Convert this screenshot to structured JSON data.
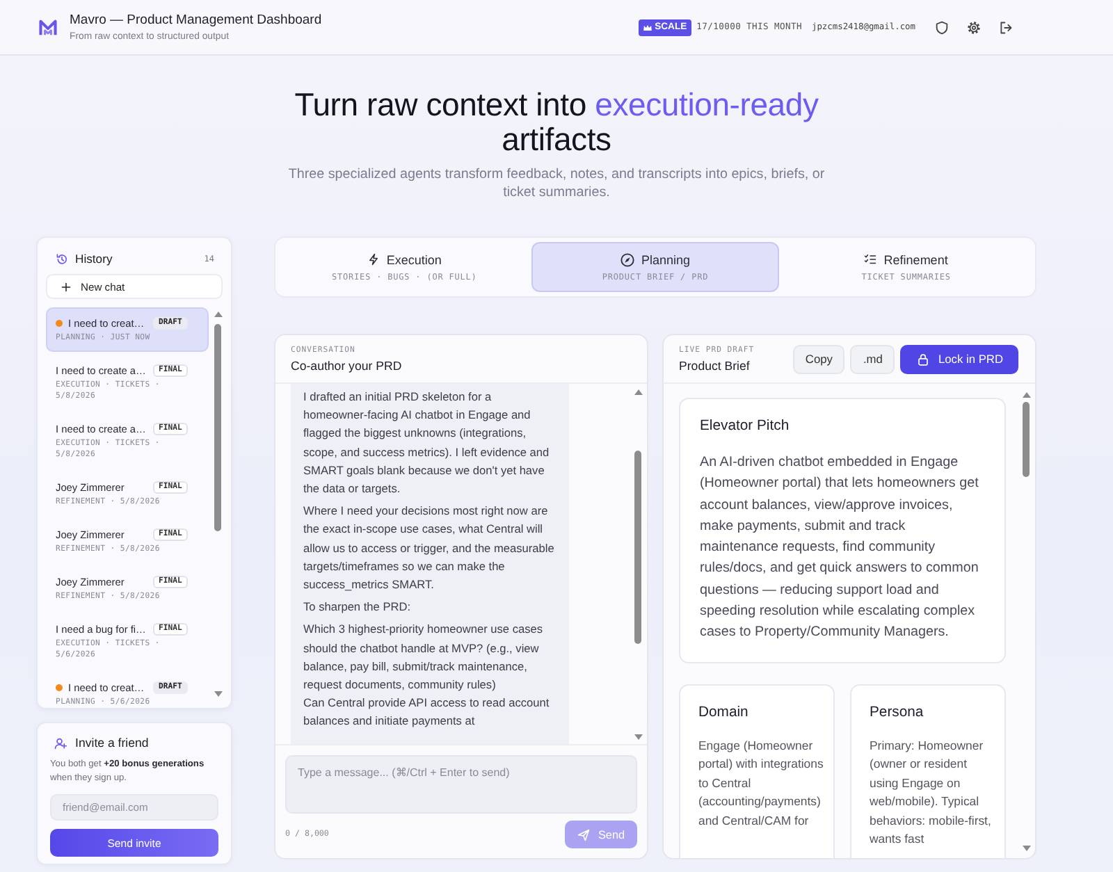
{
  "app": {
    "title": "Mavro — Product Management Dashboard",
    "subtitle": "From raw context to structured output"
  },
  "account": {
    "plan": "SCALE",
    "usage": "17/10000 THIS MONTH",
    "email": "jpzcms2418@gmail.com"
  },
  "hero": {
    "title_start": "Turn raw context into",
    "title_highlight": "execution-ready",
    "title_end": "artifacts",
    "subtitle": "Three specialized agents transform feedback, notes, and transcripts into epics, briefs, or ticket summaries."
  },
  "history": {
    "title": "History",
    "count": "14",
    "new_chat": "New chat",
    "items": [
      {
        "title": "I need to creat…",
        "status": "DRAFT",
        "draft": true,
        "meta": "PLANNING · JUST NOW",
        "selected": true
      },
      {
        "title": "I need to create a…",
        "status": "FINAL",
        "draft": false,
        "meta": "EXECUTION · TICKETS · 5/8/2026",
        "selected": false
      },
      {
        "title": "I need to create a…",
        "status": "FINAL",
        "draft": false,
        "meta": "EXECUTION · TICKETS · 5/8/2026",
        "selected": false
      },
      {
        "title": "Joey Zimmerer",
        "status": "FINAL",
        "draft": false,
        "meta": "REFINEMENT · 5/8/2026",
        "selected": false
      },
      {
        "title": "Joey Zimmerer",
        "status": "FINAL",
        "draft": false,
        "meta": "REFINEMENT · 5/8/2026",
        "selected": false
      },
      {
        "title": "Joey Zimmerer",
        "status": "FINAL",
        "draft": false,
        "meta": "REFINEMENT · 5/8/2026",
        "selected": false
      },
      {
        "title": "I need a bug for fi…",
        "status": "FINAL",
        "draft": false,
        "meta": "EXECUTION · TICKETS · 5/6/2026",
        "selected": false
      },
      {
        "title": "I need to creat…",
        "status": "DRAFT",
        "draft": true,
        "meta": "PLANNING · 5/6/2026",
        "selected": false
      }
    ]
  },
  "invite": {
    "title": "Invite a friend",
    "text": "You both get **+20 bonus generations** when they sign up.",
    "placeholder": "friend@email.com",
    "button": "Send invite"
  },
  "tabs": [
    {
      "label": "Execution",
      "sub": "STORIES · BUGS · (OR FULL)",
      "selected": false
    },
    {
      "label": "Planning",
      "sub": "PRODUCT BRIEF / PRD",
      "selected": true
    },
    {
      "label": "Refinement",
      "sub": "TICKET SUMMARIES",
      "selected": false
    }
  ],
  "conversation": {
    "eyebrow": "CONVERSATION",
    "title": "Co-author your PRD",
    "message": {
      "paragraphs": [
        "I drafted an initial PRD skeleton for a homeowner-facing AI chatbot in Engage and flagged the biggest unknowns (integrations, scope, and success metrics). I left evidence and SMART goals blank because we don't yet have the data or targets.",
        "Where I need your decisions most right now are the exact in-scope use cases, what Central will allow us to access or trigger, and the measurable targets/timeframes so we can make the success_metrics SMART.",
        "To sharpen the PRD:"
      ],
      "items": [
        "Which 3 highest-priority homeowner use cases should the chatbot handle at MVP? (e.g., view balance, pay bill, submit/track maintenance, request documents, community rules)",
        "Can Central provide API access to read account balances and initiate payments at"
      ]
    },
    "placeholder": "Type a message... (⌘/Ctrl + Enter to send)",
    "counter": "0 / 8,000",
    "send": {
      "label": "Send",
      "disabled": true
    }
  },
  "draft": {
    "eyebrow": "LIVE PRD DRAFT",
    "title": "Product Brief",
    "actions": [
      {
        "label": "Copy",
        "kind": "plain"
      },
      {
        "label": ".md",
        "kind": "plain"
      },
      {
        "label": "Lock in PRD",
        "kind": "primary"
      }
    ],
    "sections": [
      {
        "title": "Elevator Pitch",
        "kind": "wide",
        "text": "An AI-driven chatbot embedded in Engage (Homeowner portal) that lets homeowners get account balances, view/approve invoices, make payments, submit and track maintenance requests, find community rules/docs, and get quick answers to common questions — reducing support load and speeding resolution while escalating complex cases to Property/Community Managers."
      },
      {
        "title": "Domain",
        "kind": "half",
        "text": "Engage (Homeowner portal) with integrations to Central (accounting/payments) and Central/CAM for"
      },
      {
        "title": "Persona",
        "kind": "half",
        "text": "Primary: Homeowner (owner or resident using Engage on web/mobile). Typical behaviors: mobile-first, wants fast"
      }
    ]
  }
}
